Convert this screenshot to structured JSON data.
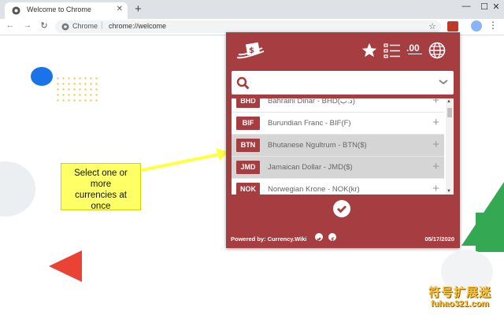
{
  "browser": {
    "tab_title": "Welcome to Chrome",
    "tab_close": "✕",
    "new_tab": "+",
    "win_minimize": "—",
    "win_maximize": "☐",
    "win_close": "✕",
    "back": "←",
    "forward": "→",
    "reload": "↻",
    "site_label": "Chrome",
    "separator": "|",
    "url": "chrome://welcome",
    "bookmark_star": "☆",
    "menu": "⋮"
  },
  "annotation": {
    "line1": "Select one or",
    "line2": "more",
    "line3": "currencies at",
    "line4": "once"
  },
  "extension": {
    "accent_color": "#a63d40",
    "search_placeholder": "",
    "currencies": [
      {
        "code": "BHD",
        "name": "Bahraini Dinar - BHD(د.ب)",
        "selected": false
      },
      {
        "code": "BIF",
        "name": "Burundian Franc - BIF(F)",
        "selected": false
      },
      {
        "code": "BTN",
        "name": "Bhutanese Ngultrum - BTN($)",
        "selected": true
      },
      {
        "code": "JMD",
        "name": "Jamaican Dollar - JMD($)",
        "selected": true
      },
      {
        "code": "NOK",
        "name": "Norwegian Krone - NOK(kr)",
        "selected": false
      }
    ],
    "add_symbol": "+",
    "decimals_label": ".00",
    "powered_by": "Powered by: Currency.Wiki",
    "date": "05/17/2020"
  },
  "watermark": {
    "line1": "符号扩展迷",
    "line2": "fuhao321.com"
  },
  "icons": {
    "logo": "currency-wiki-logo",
    "favorite": "star-icon",
    "list": "list-icon",
    "decimals": "decimals-icon",
    "language": "globe-icon",
    "search": "search-icon",
    "dropdown": "chevron-down-icon",
    "confirm": "checkmark-icon",
    "twitter": "twitter-icon",
    "facebook": "facebook-icon"
  }
}
